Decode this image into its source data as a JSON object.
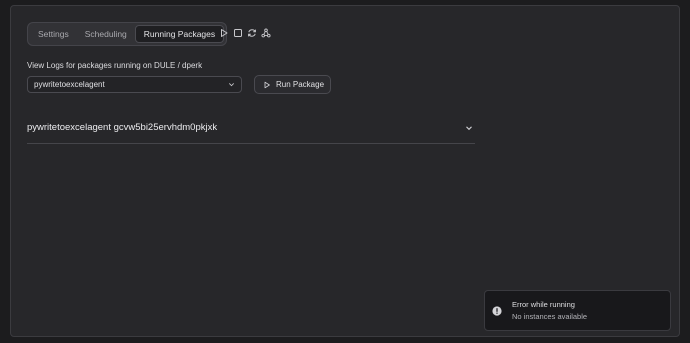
{
  "tabs": [
    {
      "label": "Settings",
      "active": false
    },
    {
      "label": "Scheduling",
      "active": false
    },
    {
      "label": "Running Packages",
      "active": true
    }
  ],
  "toolbar_icons": [
    "play-icon",
    "stop-icon",
    "refresh-icon",
    "graph-icon"
  ],
  "logs": {
    "label": "View Logs for packages running on DULE / dperk",
    "select_value": "pywritetoexcelagent",
    "run_button_label": "Run Package"
  },
  "instance": {
    "title": "pywritetoexcelagent gcvw5bi25ervhdm0pkjxk"
  },
  "toast": {
    "title": "Error while running",
    "description": "No instances available"
  },
  "colors": {
    "background": "#1c1c1e",
    "panel": "#27272a",
    "border": "#3b3b3f"
  }
}
